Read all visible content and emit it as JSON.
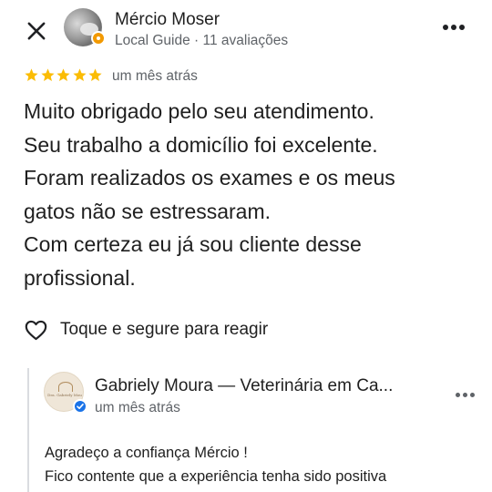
{
  "icons": {
    "close": "close-icon",
    "more": "more-horizontal-icon",
    "star": "star-icon",
    "heart": "heart-outline-icon",
    "local_guide_badge": "local-guide-badge-icon",
    "verified": "verified-check-icon"
  },
  "colors": {
    "star": "#fbbc04",
    "secondary_text": "#5f6368",
    "primary_text": "#1f1f1f",
    "local_guide": "#f29900",
    "verified": "#1a73e8"
  },
  "review": {
    "author_name": "Mércio Moser",
    "author_meta": "Local Guide · 11 avaliações",
    "rating": 5,
    "time": "um mês atrás",
    "text_lines": [
      "Muito obrigado pelo seu atendimento.",
      "Seu trabalho a domicílio foi excelente.",
      "Foram realizados os exames e os meus",
      "gatos não se estressaram.",
      "Com certeza eu já sou cliente desse",
      "profissional."
    ],
    "react_label": "Toque e segure para reagir"
  },
  "owner_reply": {
    "name": "Gabriely Moura — Veterinária em Ca...",
    "time": "um mês atrás",
    "logo_text": "Dra. Gabriely Mou",
    "text_lines": [
      "Agradeço a confiança Mércio !",
      "Fico contente que a experiência tenha sido positiva"
    ]
  }
}
